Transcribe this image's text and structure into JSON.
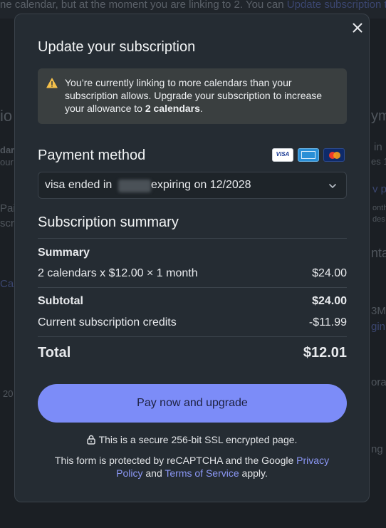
{
  "background": {
    "top_text": "ne calendar, but at the moment you are linking to 2. You can ",
    "top_link": "Update subscription to",
    "fragments": [
      "io",
      "dar",
      "our",
      "Pai",
      "scr",
      "Ca",
      "20",
      "ym",
      "in",
      "es 1",
      "v p",
      "onth",
      "des",
      "nta",
      "3M",
      "gin",
      "ora",
      "ng c"
    ]
  },
  "modal": {
    "title": "Update your subscription",
    "warning": {
      "icon": "warning-icon",
      "text_before": "You’re currently linking to more calendars than your subscription allows. Upgrade your subscription to increase your allowance to ",
      "text_bold": "2 calendars",
      "text_after": "."
    },
    "payment_method": {
      "label": "Payment method",
      "cards": [
        "VISA",
        "American Express",
        "Mastercard"
      ],
      "selected_prefix": "visa ended in",
      "selected_suffix": "expiring on 12/2028"
    },
    "summary": {
      "label": "Subscription summary",
      "header": "Summary",
      "line_item": "2 calendars x $12.00 × 1 month",
      "line_item_amount": "$24.00",
      "subtotal_label": "Subtotal",
      "subtotal_amount": "$24.00",
      "credits_label": "Current subscription credits",
      "credits_amount": "-$11.99",
      "total_label": "Total",
      "total_amount": "$12.01"
    },
    "pay_button": "Pay now and upgrade",
    "secure_text": "This is a secure 256-bit SSL encrypted page.",
    "legal": {
      "before": "This form is protected by reCAPTCHA and the Google ",
      "privacy": "Privacy Policy",
      "and": " and ",
      "terms": "Terms of Service",
      "after": " apply."
    }
  },
  "colors": {
    "accent": "#7c8cf8",
    "link": "#8b97f5",
    "warning_icon": "#f5c04a"
  }
}
